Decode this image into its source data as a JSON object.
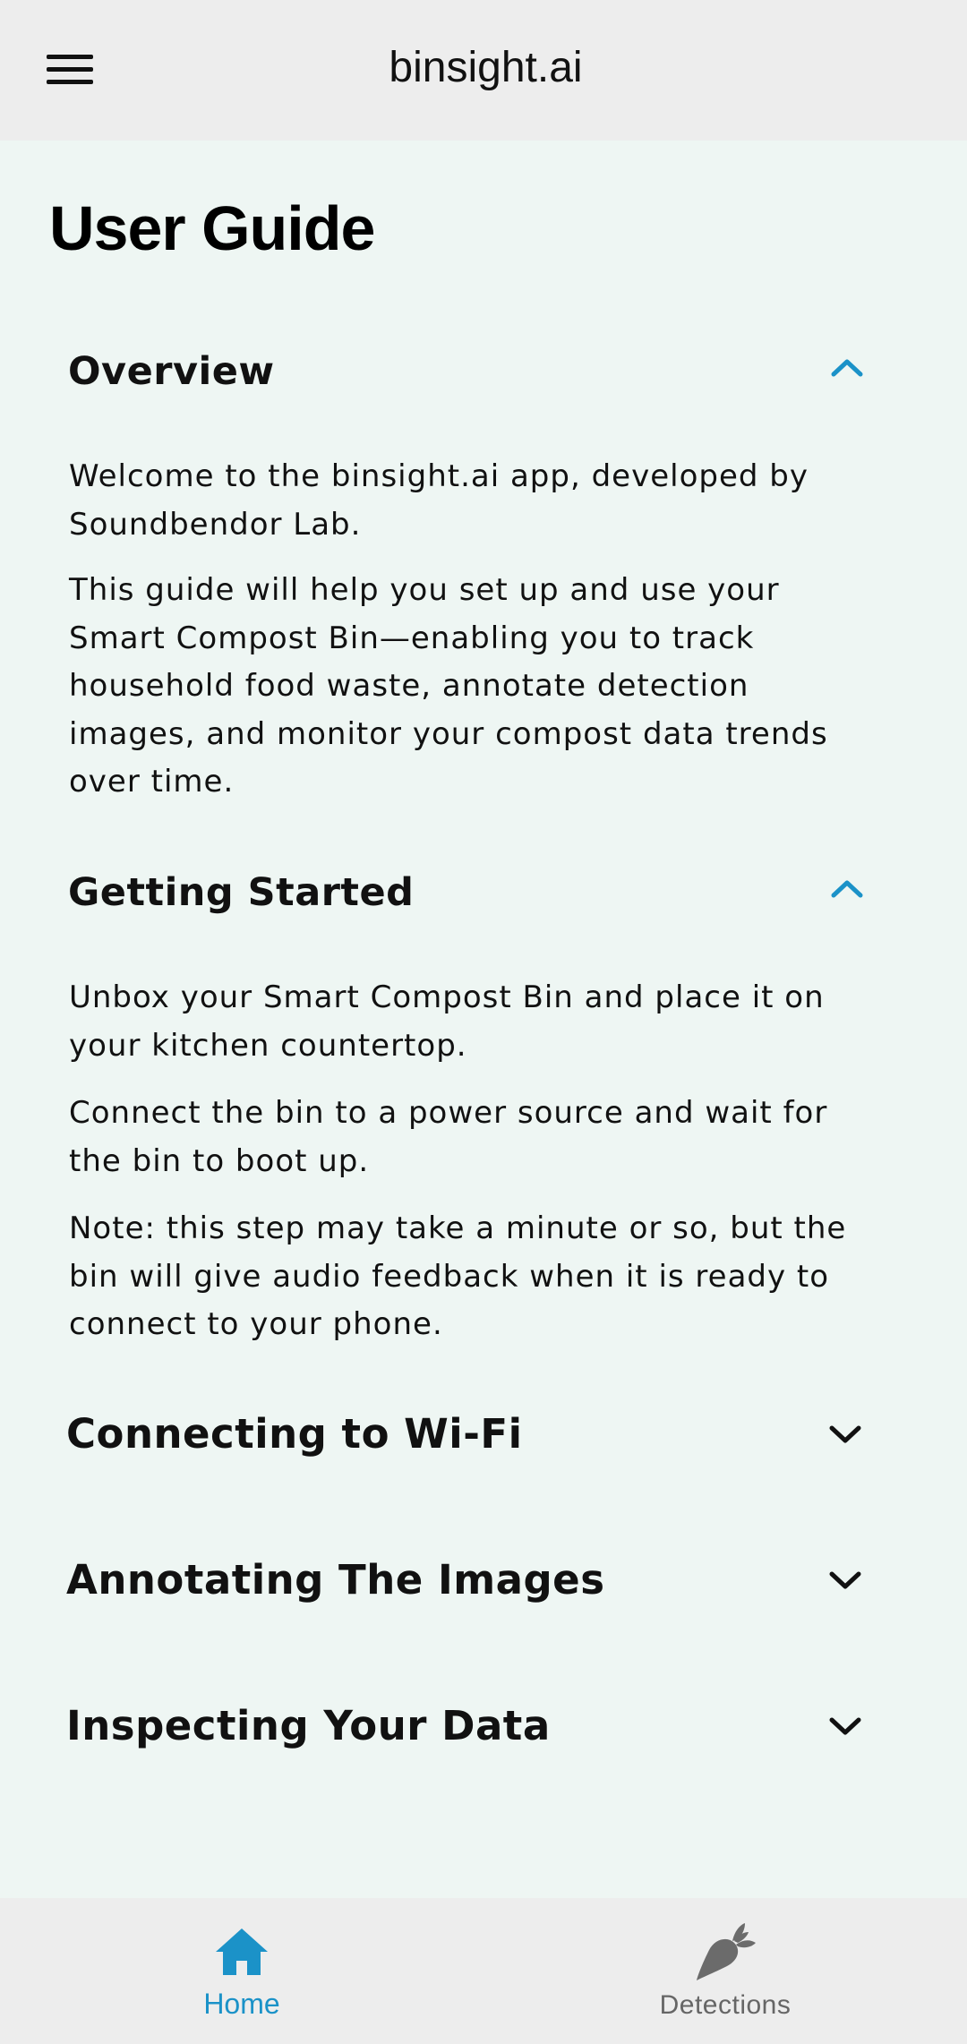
{
  "header": {
    "app_title": "binsight.ai",
    "menu_icon": "hamburger-menu-icon"
  },
  "page": {
    "title": "User Guide"
  },
  "sections": [
    {
      "title": "Overview",
      "expanded": true,
      "paragraphs": [
        "Welcome to the binsight.ai app, developed by Soundbendor Lab.",
        "This guide will help you set up and use your Smart Compost Bin—enabling you to track household food waste, annotate detection images, and monitor your compost data trends over time."
      ]
    },
    {
      "title": "Getting Started",
      "expanded": true,
      "paragraphs": [
        "Unbox your Smart Compost Bin and place it on your kitchen countertop.",
        "Connect the bin to a power source and wait for the bin to boot up.",
        "Note: this step may take a minute or so, but the bin will give audio feedback when it is ready to connect to your phone."
      ]
    },
    {
      "title": "Connecting to Wi-Fi",
      "expanded": false
    },
    {
      "title": "Annotating The Images",
      "expanded": false
    },
    {
      "title": "Inspecting Your Data",
      "expanded": false
    }
  ],
  "bottom_nav": {
    "items": [
      {
        "label": "Home",
        "icon": "home-icon",
        "active": true
      },
      {
        "label": "Detections",
        "icon": "carrot-icon",
        "active": false
      }
    ]
  },
  "colors": {
    "accent": "#1b92c8",
    "background": "#eef6f3",
    "bar": "#ededed",
    "inactive": "#666666"
  }
}
